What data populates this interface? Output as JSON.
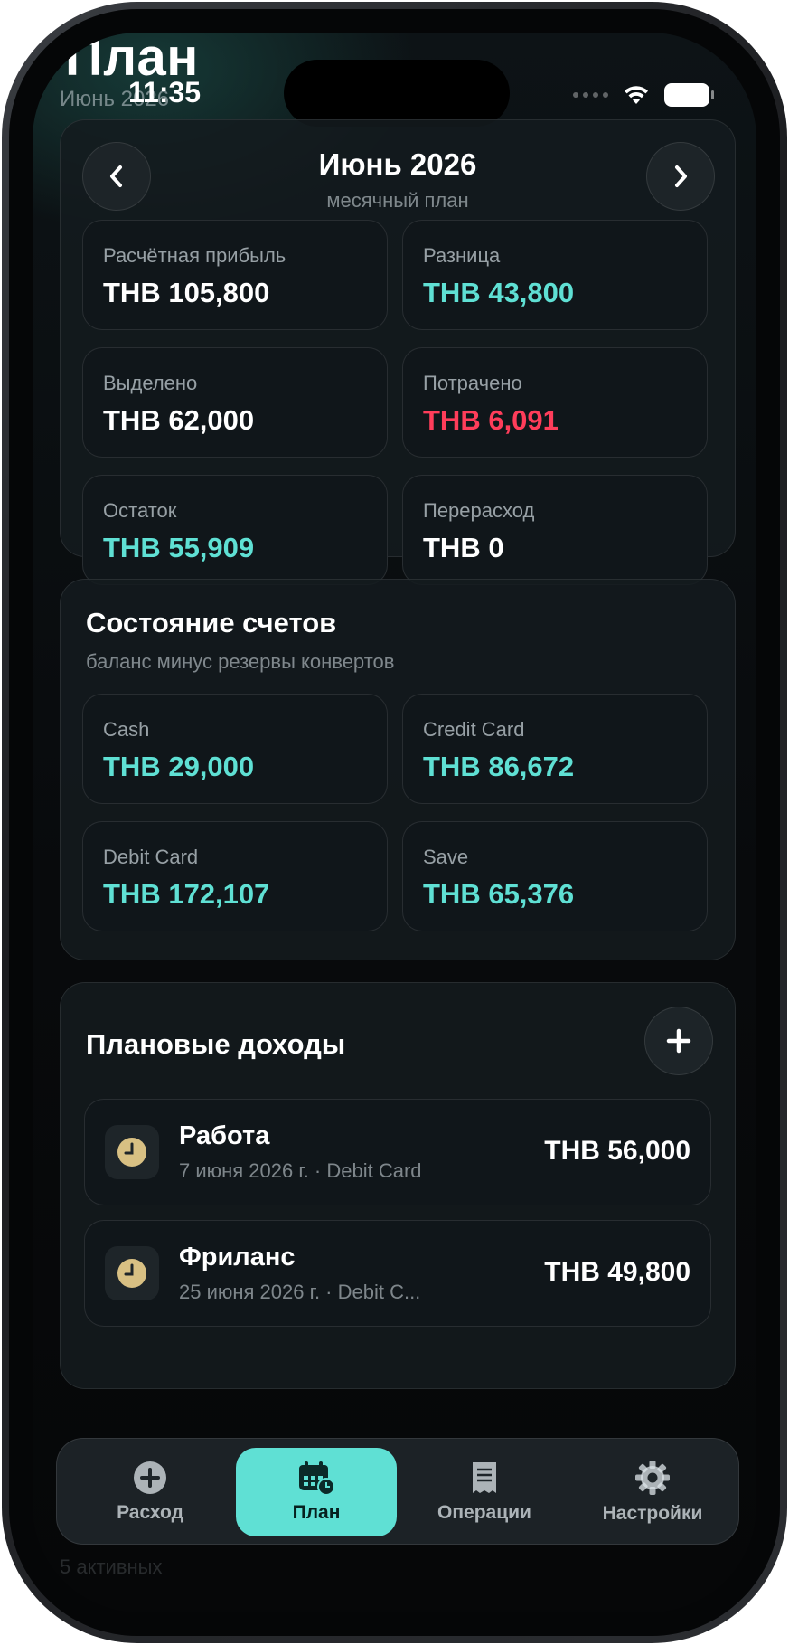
{
  "header": {
    "big_title": "План",
    "big_subtitle": "Июнь 2026",
    "time": "11:35"
  },
  "month_card": {
    "title": "Июнь 2026",
    "subtitle": "месячный план",
    "tiles": [
      {
        "label": "Расчётная прибыль",
        "value": "THB 105,800",
        "tone": "white"
      },
      {
        "label": "Разница",
        "value": "THB 43,800",
        "tone": "teal"
      },
      {
        "label": "Выделено",
        "value": "THB 62,000",
        "tone": "white"
      },
      {
        "label": "Потрачено",
        "value": "THB 6,091",
        "tone": "red"
      },
      {
        "label": "Остаток",
        "value": "THB 55,909",
        "tone": "teal"
      },
      {
        "label": "Перерасход",
        "value": "THB 0",
        "tone": "white"
      }
    ]
  },
  "accounts": {
    "title": "Состояние счетов",
    "subtitle": "баланс минус резервы конвертов",
    "tiles": [
      {
        "label": "Cash",
        "value": "THB 29,000"
      },
      {
        "label": "Credit Card",
        "value": "THB 86,672"
      },
      {
        "label": "Debit Card",
        "value": "THB 172,107"
      },
      {
        "label": "Save",
        "value": "THB 65,376"
      }
    ]
  },
  "income": {
    "title": "Плановые доходы",
    "items": [
      {
        "title": "Работа",
        "meta": "7 июня 2026 г. · Debit Card",
        "amount": "THB 56,000",
        "icon": "clock-icon"
      },
      {
        "title": "Фриланс",
        "meta": "25 июня 2026 г. · Debit C...",
        "amount": "THB 49,800",
        "icon": "clock-icon"
      }
    ]
  },
  "tabbar": {
    "tabs": [
      {
        "label": "Расход",
        "icon": "plus-circle-icon"
      },
      {
        "label": "План",
        "icon": "calendar-clock-icon"
      },
      {
        "label": "Операции",
        "icon": "receipt-icon"
      },
      {
        "label": "Настройки",
        "icon": "gear-icon"
      }
    ]
  },
  "behind_text": "5 активных",
  "colors": {
    "accent": "#5fe0d4",
    "negative": "#ff3d5a",
    "clock": "#d8c083",
    "background": "#0b0f12"
  }
}
